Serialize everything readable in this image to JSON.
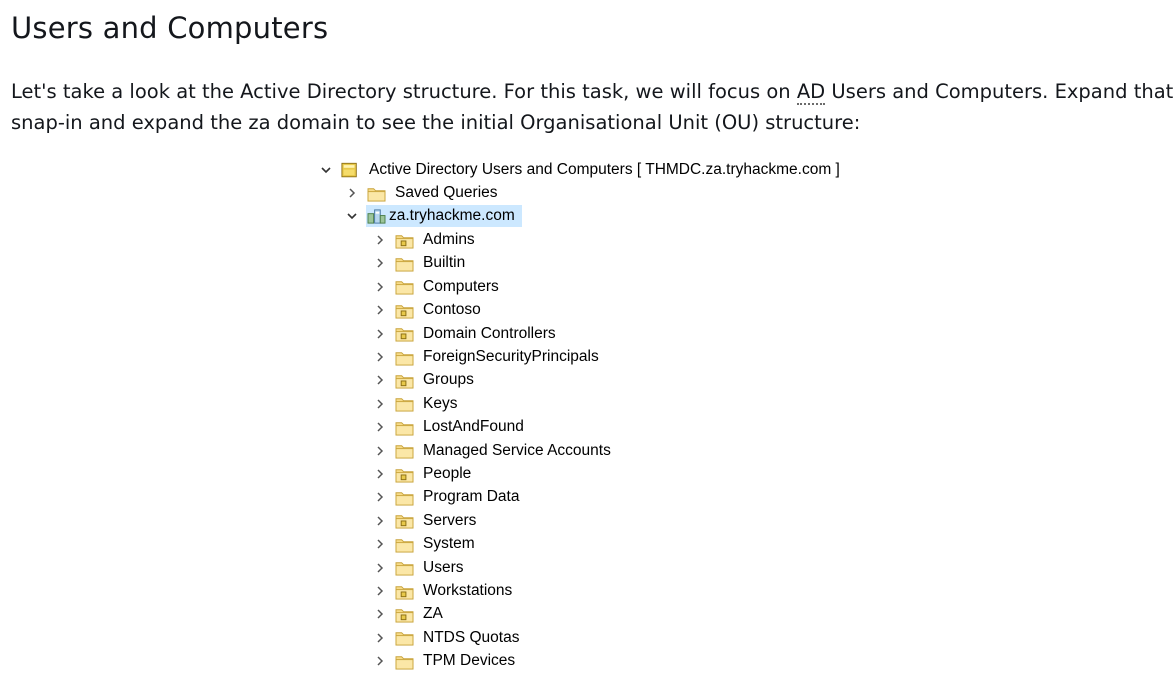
{
  "heading": "Users and Computers",
  "paragraph": {
    "before_ad": "Let's take a look at the Active Directory structure. For this task, we will focus on ",
    "ad_abbr": "AD",
    "after_ad_line1": " Users and Computers. Expand that",
    "line2": "snap-in and expand the za domain to see the initial Organisational Unit (OU) structure:"
  },
  "tree": {
    "root": {
      "label": "Active Directory Users and Computers [ THMDC.za.tryhackme.com ]",
      "icon": "snapin-icon",
      "expanded": true
    },
    "saved_queries": {
      "label": "Saved Queries",
      "icon": "folder-icon"
    },
    "domain": {
      "label": "za.tryhackme.com",
      "icon": "domain-icon",
      "expanded": true,
      "selected": true
    },
    "children": [
      {
        "label": "Admins",
        "icon": "ou-icon"
      },
      {
        "label": "Builtin",
        "icon": "folder-icon"
      },
      {
        "label": "Computers",
        "icon": "folder-icon"
      },
      {
        "label": "Contoso",
        "icon": "ou-icon"
      },
      {
        "label": "Domain Controllers",
        "icon": "ou-icon"
      },
      {
        "label": "ForeignSecurityPrincipals",
        "icon": "folder-icon"
      },
      {
        "label": "Groups",
        "icon": "ou-icon"
      },
      {
        "label": "Keys",
        "icon": "folder-icon"
      },
      {
        "label": "LostAndFound",
        "icon": "folder-icon"
      },
      {
        "label": "Managed Service Accounts",
        "icon": "folder-icon"
      },
      {
        "label": "People",
        "icon": "ou-icon"
      },
      {
        "label": "Program Data",
        "icon": "folder-icon"
      },
      {
        "label": "Servers",
        "icon": "ou-icon"
      },
      {
        "label": "System",
        "icon": "folder-icon"
      },
      {
        "label": "Users",
        "icon": "folder-icon"
      },
      {
        "label": "Workstations",
        "icon": "ou-icon"
      },
      {
        "label": "ZA",
        "icon": "ou-icon"
      },
      {
        "label": "NTDS Quotas",
        "icon": "folder-icon"
      },
      {
        "label": "TPM Devices",
        "icon": "folder-icon"
      }
    ]
  }
}
